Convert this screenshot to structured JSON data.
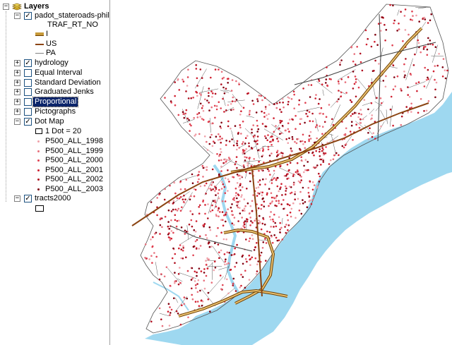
{
  "toc": {
    "root_label": "Layers",
    "layers": [
      {
        "label": "padot_stateroads-philad",
        "checked": true,
        "expanded": true
      },
      {
        "label": "hydrology",
        "checked": true,
        "expanded": false
      },
      {
        "label": "Equal Interval",
        "checked": false,
        "expanded": false
      },
      {
        "label": "Standard Deviation",
        "checked": false,
        "expanded": false
      },
      {
        "label": "Graduated Jenks",
        "checked": false,
        "expanded": false
      },
      {
        "label": "Proportional",
        "checked": false,
        "expanded": false,
        "selected": true
      },
      {
        "label": "Pictographs",
        "checked": false,
        "expanded": false
      },
      {
        "label": "Dot Map",
        "checked": true,
        "expanded": true
      },
      {
        "label": "tracts2000",
        "checked": true,
        "expanded": true
      }
    ],
    "road_legend": {
      "field": "TRAF_RT_NO",
      "classes": [
        {
          "label": "I",
          "color": "#c79a3a"
        },
        {
          "label": "US",
          "color": "#8b4513"
        },
        {
          "label": "PA",
          "color": "#808080"
        }
      ]
    },
    "dot_legend": {
      "dot_value": "1 Dot = 20",
      "fields": [
        {
          "label": "P500_ALL_1998",
          "color": "#f0a0a8"
        },
        {
          "label": "P500_ALL_1999",
          "color": "#e8707c"
        },
        {
          "label": "P500_ALL_2000",
          "color": "#e04050"
        },
        {
          "label": "P500_ALL_2001",
          "color": "#d02030"
        },
        {
          "label": "P500_ALL_2002",
          "color": "#b01020"
        },
        {
          "label": "P500_ALL_2003",
          "color": "#800010"
        }
      ]
    }
  },
  "map": {
    "water_color": "#9ed8f0",
    "tract_line_color": "#555555",
    "dot_colors": [
      "#f0a0a8",
      "#e8707c",
      "#e04050",
      "#d02030",
      "#b01020",
      "#800010"
    ]
  }
}
